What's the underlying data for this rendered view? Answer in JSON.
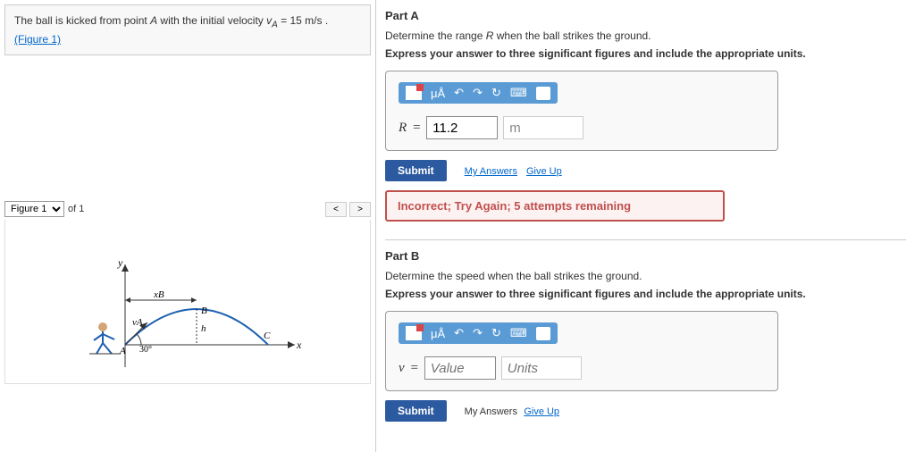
{
  "problem": {
    "text_prefix": "The ball is kicked from point ",
    "point": "A",
    "text_mid": " with the initial velocity ",
    "vel_var": "v",
    "vel_sub": "A",
    "vel_eq": " = 15 m/s .",
    "figure_link": "(Figure 1)"
  },
  "figure": {
    "select": "Figure 1",
    "of": "of 1",
    "labels": {
      "y": "y",
      "x": "x",
      "A": "A",
      "B": "B",
      "C": "C",
      "vA": "vA",
      "xB": "xB",
      "h": "h",
      "angle": "30°"
    }
  },
  "partA": {
    "title": "Part A",
    "prompt_pre": "Determine the range ",
    "prompt_var": "R",
    "prompt_post": " when the ball strikes the ground.",
    "instruct": "Express your answer to three significant figures and include the appropriate units.",
    "var": "R",
    "eq": " = ",
    "value": "11.2",
    "unit": "m",
    "toolbar_mu": "μÅ",
    "toolbar_q": "?",
    "submit": "Submit",
    "my_answers": "My Answers",
    "give_up": "Give Up",
    "feedback": "Incorrect; Try Again; 5 attempts remaining"
  },
  "partB": {
    "title": "Part B",
    "prompt": "Determine the speed when the ball strikes the ground.",
    "instruct": "Express your answer to three significant figures and include the appropriate units.",
    "var": "v",
    "eq": " = ",
    "value_ph": "Value",
    "unit_ph": "Units",
    "toolbar_mu": "μÅ",
    "toolbar_q": "?",
    "submit": "Submit",
    "my_answers": "My Answers",
    "give_up": "Give Up"
  }
}
